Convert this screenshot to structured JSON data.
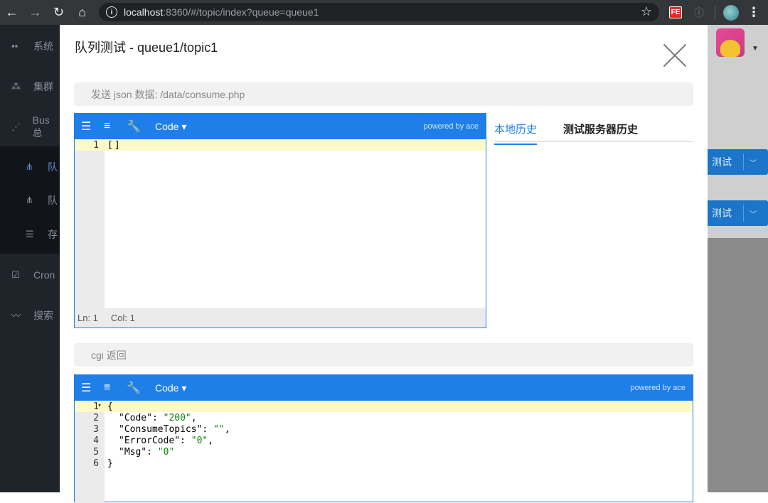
{
  "browser": {
    "url_host": "localhost",
    "url_rest": ":8360/#/topic/index?queue=queue1",
    "extension_label": "FE"
  },
  "sidebar": {
    "items": [
      {
        "label": "系统",
        "icon": "grid-icon"
      },
      {
        "label": "集群",
        "icon": "cluster-icon"
      },
      {
        "label": "Bus 总",
        "icon": "bus-icon"
      },
      {
        "label": "队",
        "icon": "queue-icon"
      },
      {
        "label": "队",
        "icon": "queue-icon"
      },
      {
        "label": "存",
        "icon": "database-icon"
      },
      {
        "label": "Cron",
        "icon": "calendar-icon"
      },
      {
        "label": "搜索",
        "icon": "search-icon"
      }
    ]
  },
  "background": {
    "test_button_label": "测试"
  },
  "modal": {
    "title": "队列测试 - queue1/topic1",
    "send_bar": "发送 json 数据: /data/consume.php",
    "return_bar": "cgi 返回",
    "tabs": [
      "本地历史",
      "测试服务器历史"
    ]
  },
  "editor_top": {
    "code_label": "Code ▾",
    "powered": "powered by ace",
    "lines": [
      "1"
    ],
    "content": "[]",
    "status_ln": "Ln: 1",
    "status_col": "Col: 1"
  },
  "editor_bottom": {
    "code_label": "Code ▾",
    "powered": "powered by ace",
    "lines": [
      "1",
      "2",
      "3",
      "4",
      "5",
      "6"
    ],
    "json": {
      "open": "{",
      "k1": "\"Code\"",
      "v1": "\"200\"",
      "k2": "\"ConsumeTopics\"",
      "v2": "\"\"",
      "k3": "\"ErrorCode\"",
      "v3": "\"0\"",
      "k4": "\"Msg\"",
      "v4": "\"0\"",
      "close": "}"
    }
  }
}
